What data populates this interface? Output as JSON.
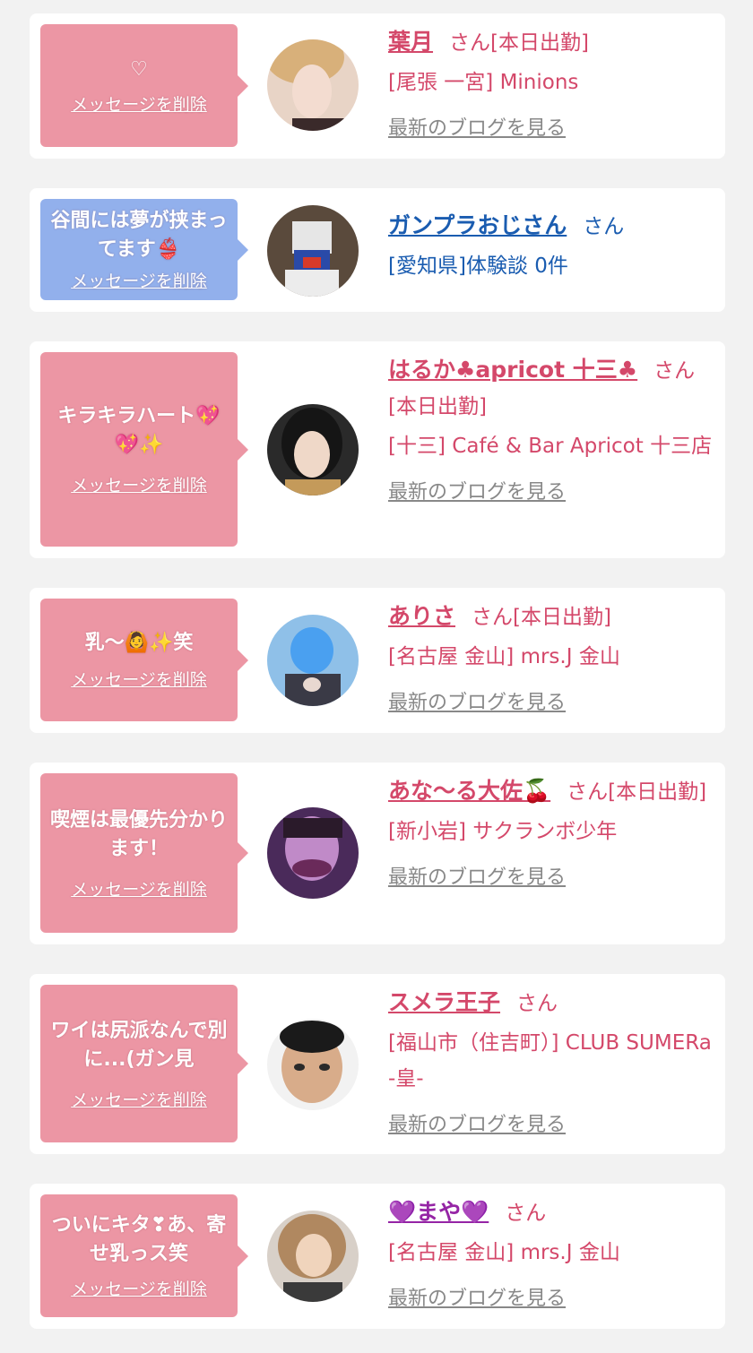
{
  "delete_label": "メッセージを削除",
  "blog_label": "最新のブログを見る",
  "san": "さん",
  "colors": {
    "accent_pink": "#d4486a",
    "bubble_pink": "#ec96a4",
    "bubble_blue": "#92b0ec",
    "link_blue": "#1a5cb0",
    "purple": "#9524a5"
  },
  "cards": [
    {
      "message": "♡",
      "name": "葉月",
      "status": "[本日出勤]",
      "shop": "[尾張 一宮] Minions"
    },
    {
      "message": "谷間には夢が挟まってます👙",
      "name": "ガンプラおじさん",
      "status": "",
      "shop": "[愛知県]体験談 0件"
    },
    {
      "message": "キラキラハート💖💖✨",
      "name": "はるか♣apricot 十三♣",
      "status": "[本日出勤]",
      "shop": "[十三] Café & Bar Apricot 十三店"
    },
    {
      "message": "乳〜🙆✨笑",
      "name": "ありさ",
      "status": "[本日出勤]",
      "shop": "[名古屋 金山] mrs.J 金山"
    },
    {
      "message": "喫煙は最優先分かります！",
      "name": "あな〜る大佐🍒",
      "status": "[本日出勤]",
      "shop": "[新小岩] サクランボ少年"
    },
    {
      "message": "ワイは尻派なんで別に...(ガン見",
      "name": "スメラ王子",
      "status": "",
      "shop": "[福山市（住吉町）] CLUB SUMERa -皇-"
    },
    {
      "message": "ついにキタ❣あ、寄せ乳っス笑",
      "name": "💜まや💜",
      "status": "",
      "shop": "[名古屋 金山] mrs.J 金山"
    }
  ]
}
